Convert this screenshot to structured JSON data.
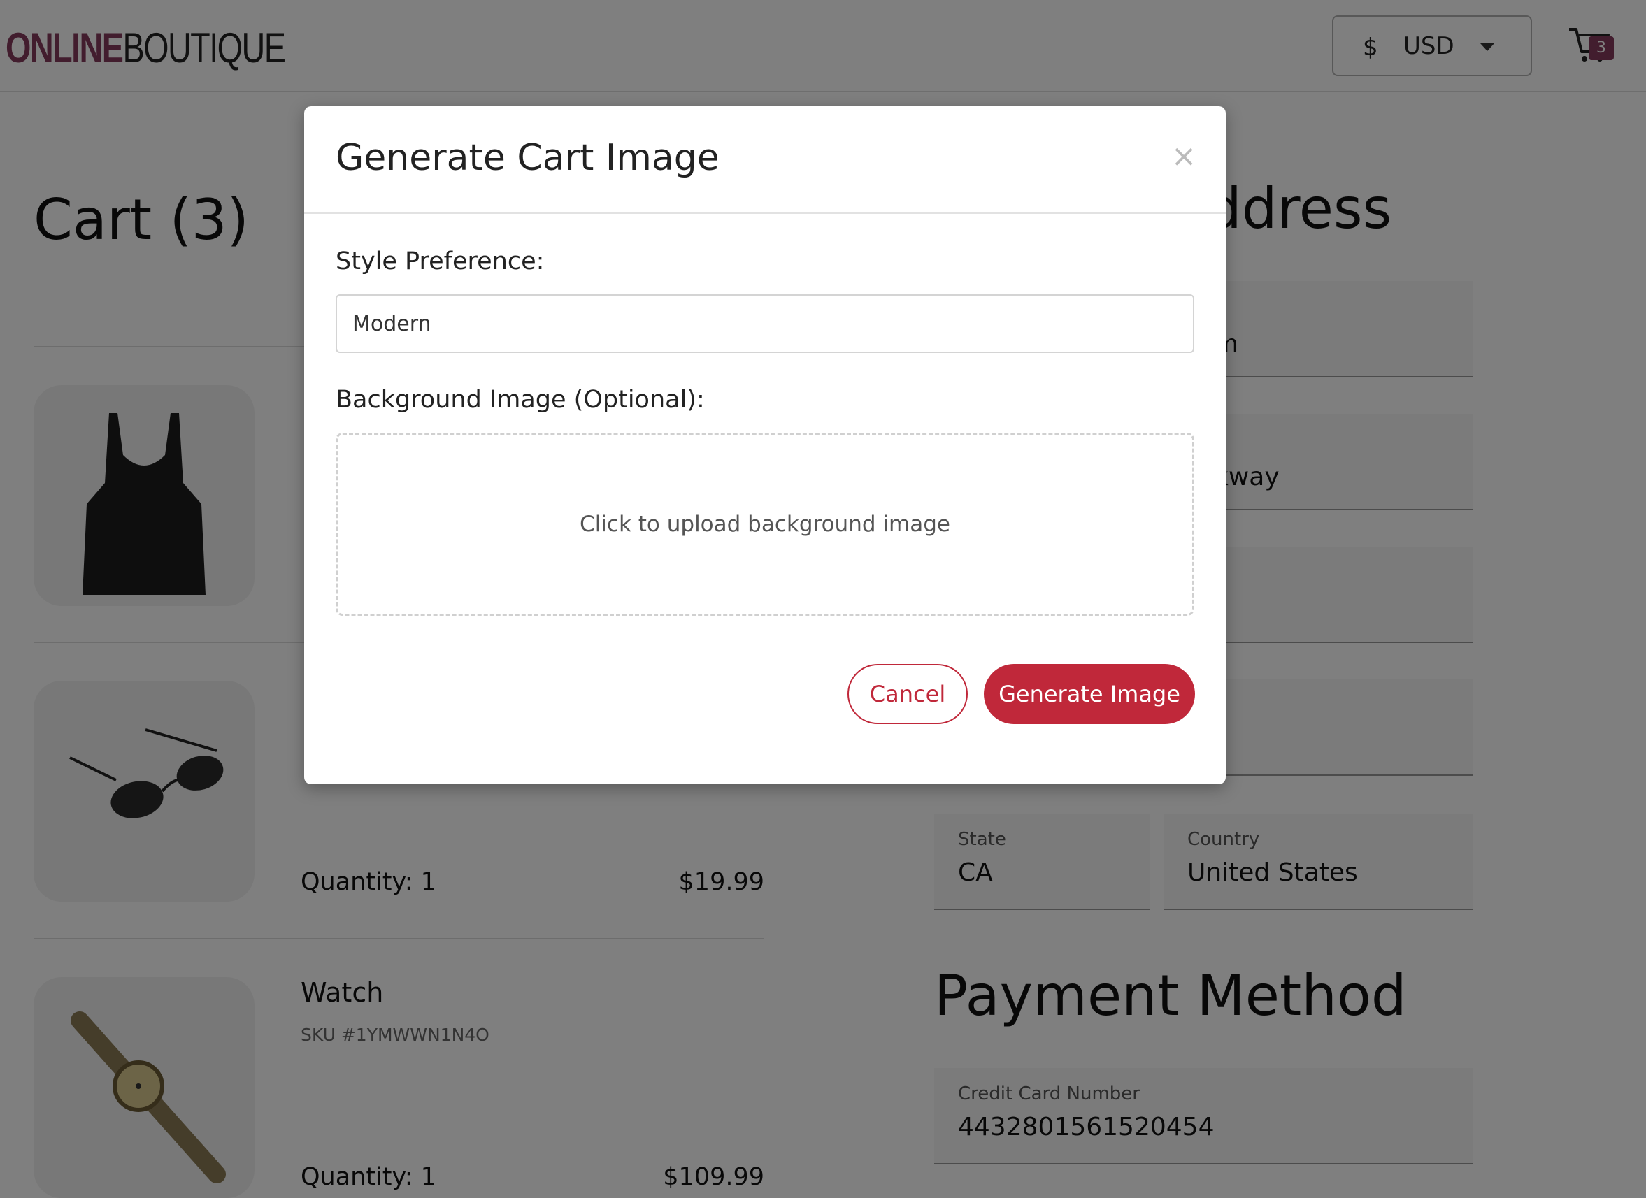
{
  "header": {
    "logo_bold": "ONLINE",
    "logo_light": "BOUTIQUE",
    "currency_symbol": "$",
    "currency": "USD",
    "cart_count": "3"
  },
  "cart": {
    "title": "Cart (3)",
    "items": [
      {
        "name": "",
        "sku": "",
        "quantity": "",
        "price": ""
      },
      {
        "name": "",
        "sku": "",
        "quantity": "Quantity: 1",
        "price": "$19.99"
      },
      {
        "name": "Watch",
        "sku": "SKU #1YMWWN1N4O",
        "quantity": "Quantity: 1",
        "price": "$109.99"
      }
    ]
  },
  "shipping": {
    "title_partial": "ddress",
    "fields": [
      {
        "label": "",
        "value_partial": "m"
      },
      {
        "label": "",
        "value_partial": "kway"
      },
      {
        "label": "",
        "value_partial": ""
      },
      {
        "label": "",
        "value_partial": ""
      }
    ],
    "state": {
      "label": "State",
      "value": "CA"
    },
    "country": {
      "label": "Country",
      "value": "United States"
    }
  },
  "payment": {
    "title": "Payment Method",
    "card_label": "Credit Card Number",
    "card_value": "4432801561520454"
  },
  "modal": {
    "title": "Generate Cart Image",
    "close_glyph": "×",
    "style_label": "Style Preference:",
    "style_value": "Modern",
    "bg_label": "Background Image (Optional):",
    "upload_text": "Click to upload background image",
    "cancel_label": "Cancel",
    "generate_label": "Generate Image"
  },
  "colors": {
    "brand": "#853b5c",
    "accent_red": "#c0283a",
    "overlay": "rgba(0,0,0,0.5)"
  }
}
